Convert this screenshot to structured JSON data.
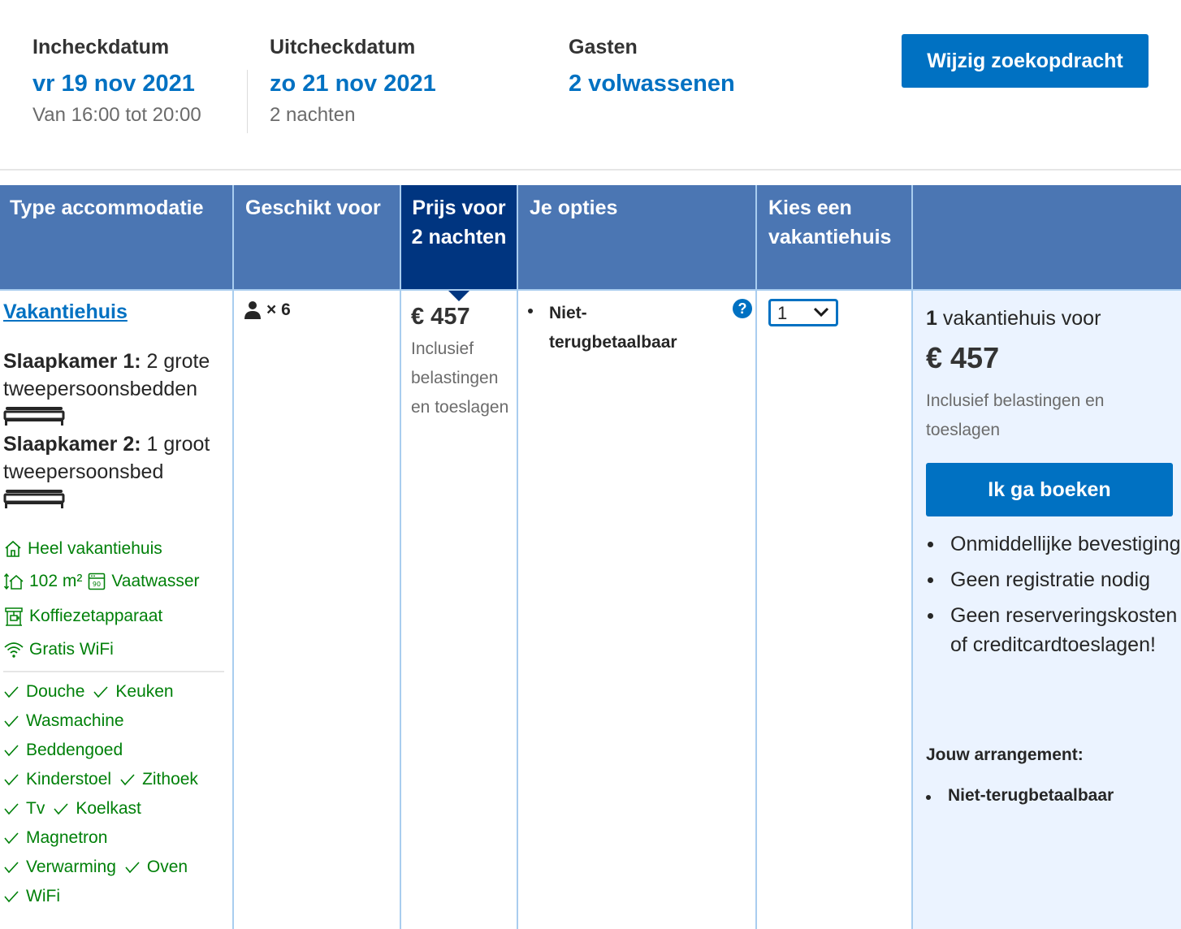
{
  "search": {
    "checkin_label": "Incheckdatum",
    "checkin_date": "vr 19 nov 2021",
    "checkin_time": "Van 16:00 tot 20:00",
    "checkout_label": "Uitcheckdatum",
    "checkout_date": "zo 21 nov 2021",
    "nights": "2 nachten",
    "guests_label": "Gasten",
    "guests_value": "2 volwassenen",
    "modify_button": "Wijzig zoekopdracht"
  },
  "table": {
    "headers": {
      "type": "Type accommodatie",
      "suitable": "Geschikt voor",
      "price": "Prijs voor 2 nachten",
      "options": "Je opties",
      "choose": "Kies een vakantiehuis"
    },
    "room": {
      "name": "Vakantiehuis",
      "bedroom1_label": "Slaapkamer 1:",
      "bedroom1_beds": "2 grote tweepersoonsbedden",
      "bedroom2_label": "Slaapkamer 2:",
      "bedroom2_beds": "1 groot tweepersoonsbed",
      "facilities": {
        "whole_house": "Heel vakantiehuis",
        "size": "102 m²",
        "dishwasher": "Vaatwasser",
        "coffee": "Koffiezetapparaat",
        "wifi": "Gratis WiFi"
      },
      "amenities": [
        [
          "Douche",
          "Keuken"
        ],
        [
          "Wasmachine"
        ],
        [
          "Beddengoed"
        ],
        [
          "Kinderstoel",
          "Zithoek"
        ],
        [
          "Tv",
          "Koelkast"
        ],
        [
          "Magnetron"
        ],
        [
          "Verwarming",
          "Oven"
        ],
        [
          "WiFi"
        ]
      ]
    },
    "occupancy": "× 6",
    "price": "€ 457",
    "price_note": "Inclusief belastingen en toeslagen",
    "option": "Niet-terugbetaalbaar",
    "quantity": "1",
    "summary": {
      "count": "1",
      "count_suffix": " vakantiehuis voor",
      "price": "€ 457",
      "note": "Inclusief belastingen en toeslagen",
      "book_button": "Ik ga boeken",
      "benefits": [
        "Onmiddellijke bevestiging",
        "Geen registratie nodig",
        "Geen reserveringskosten of creditcardtoeslagen!"
      ],
      "arrangement_title": "Jouw arrangement:",
      "arrangement_item": "Niet-terugbetaalbaar"
    }
  },
  "colors": {
    "link_blue": "#0071c2",
    "header_blue": "#4b76b3",
    "header_active": "#003580",
    "facility_green": "#008009",
    "summary_bg": "#ebf3ff"
  }
}
